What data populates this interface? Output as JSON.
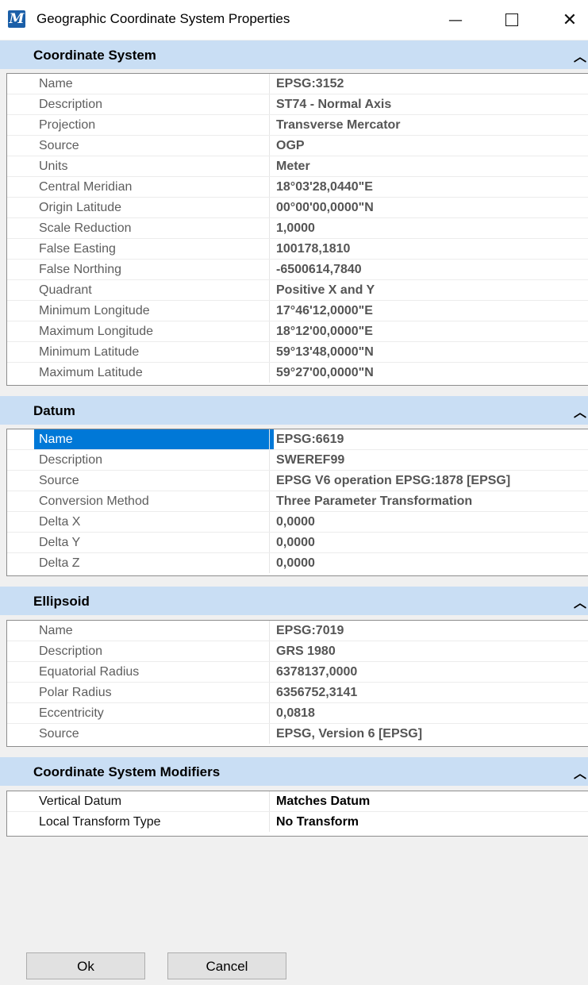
{
  "window": {
    "title": "Geographic Coordinate System Properties",
    "icon_glyph": "M",
    "minimize_glyph": "—",
    "close_glyph": "✕"
  },
  "sections": [
    {
      "title": "Coordinate System",
      "rows": [
        {
          "name": "Name",
          "value": "EPSG:3152"
        },
        {
          "name": "Description",
          "value": "ST74 - Normal Axis"
        },
        {
          "name": "Projection",
          "value": "Transverse Mercator"
        },
        {
          "name": "Source",
          "value": "OGP"
        },
        {
          "name": "Units",
          "value": "Meter"
        },
        {
          "name": "Central Meridian",
          "value": "18°03'28,0440\"E"
        },
        {
          "name": "Origin Latitude",
          "value": "00°00'00,0000\"N"
        },
        {
          "name": "Scale Reduction",
          "value": "1,0000"
        },
        {
          "name": "False Easting",
          "value": "100178,1810"
        },
        {
          "name": "False Northing",
          "value": "-6500614,7840"
        },
        {
          "name": "Quadrant",
          "value": "Positive X and Y"
        },
        {
          "name": "Minimum Longitude",
          "value": "17°46'12,0000\"E"
        },
        {
          "name": "Maximum Longitude",
          "value": "18°12'00,0000\"E"
        },
        {
          "name": "Minimum Latitude",
          "value": "59°13'48,0000\"N"
        },
        {
          "name": "Maximum Latitude",
          "value": "59°27'00,0000\"N"
        }
      ]
    },
    {
      "title": "Datum",
      "rows": [
        {
          "name": "Name",
          "value": "EPSG:6619",
          "selected": true
        },
        {
          "name": "Description",
          "value": "SWEREF99"
        },
        {
          "name": "Source",
          "value": "EPSG V6 operation EPSG:1878 [EPSG]"
        },
        {
          "name": "Conversion Method",
          "value": "Three Parameter Transformation"
        },
        {
          "name": "Delta X",
          "value": "0,0000"
        },
        {
          "name": "Delta Y",
          "value": "0,0000"
        },
        {
          "name": "Delta Z",
          "value": "0,0000"
        }
      ]
    },
    {
      "title": "Ellipsoid",
      "rows": [
        {
          "name": "Name",
          "value": "EPSG:7019"
        },
        {
          "name": "Description",
          "value": "GRS 1980"
        },
        {
          "name": "Equatorial Radius",
          "value": "6378137,0000"
        },
        {
          "name": "Polar Radius",
          "value": "6356752,3141"
        },
        {
          "name": "Eccentricity",
          "value": "0,0818"
        },
        {
          "name": "Source",
          "value": "EPSG, Version 6 [EPSG]"
        }
      ]
    },
    {
      "title": "Coordinate System Modifiers",
      "rows": [
        {
          "name": "Vertical Datum",
          "value": "Matches Datum"
        },
        {
          "name": "Local Transform Type",
          "value": "No Transform"
        }
      ]
    }
  ],
  "buttons": {
    "ok": "Ok",
    "cancel": "Cancel"
  },
  "icons": {
    "collapse": "chevron-up-icon",
    "app": "microstation-app-icon"
  },
  "colors": {
    "section_header": "#c9def4",
    "selection": "#0078d7"
  }
}
